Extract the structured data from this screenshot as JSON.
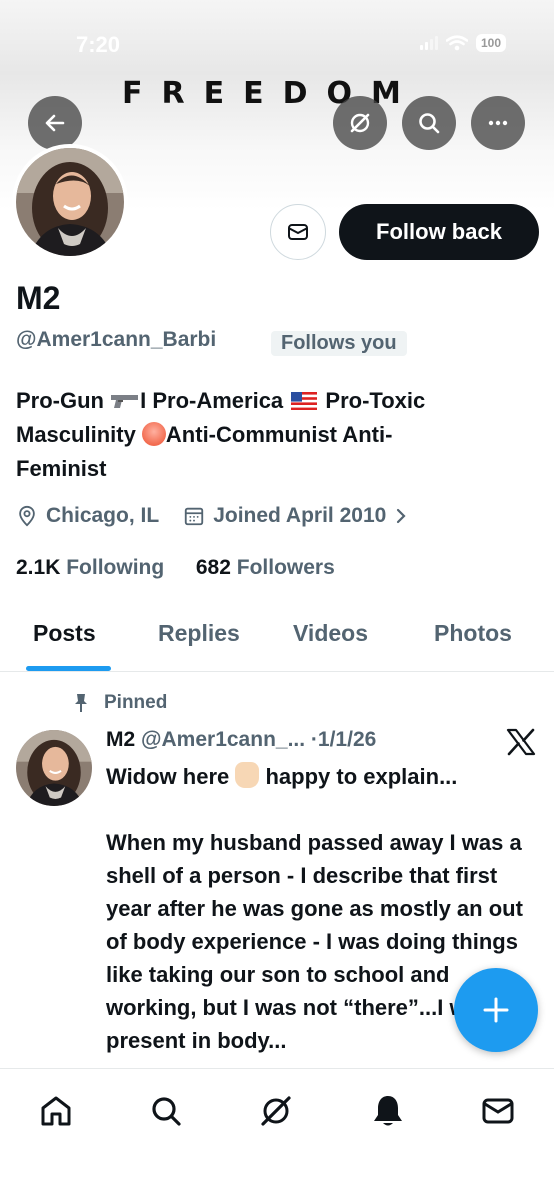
{
  "status_bar": {
    "time": "7:20",
    "battery": "100"
  },
  "banner": {
    "text": "FREEDOM"
  },
  "profile": {
    "name": "M2",
    "handle": "@Amer1cann_Barbi",
    "follows_you": "Follows you",
    "follow_button": "Follow back",
    "bio": {
      "line1_a": "Pro-Gun ",
      "line1_b": "I Pro-America ",
      "line1_c": " Pro-Toxic",
      "line2_a": "Masculinity ",
      "line2_b": "Anti-Communist Anti-",
      "line3": "Feminist"
    },
    "location": "Chicago, IL",
    "joined": "Joined April 2010",
    "following_count": "2.1K",
    "following_label": "Following",
    "followers_count": "682",
    "followers_label": "Followers"
  },
  "tabs": [
    {
      "label": "Posts",
      "active": true
    },
    {
      "label": "Replies",
      "active": false
    },
    {
      "label": "Videos",
      "active": false
    },
    {
      "label": "Photos",
      "active": false
    }
  ],
  "pinned_post": {
    "pinned_label": "Pinned",
    "author": "M2",
    "handle": "@Amer1cann_...",
    "separator": "·",
    "date": "1/1/26",
    "line1_a": "Widow here ",
    "line1_b": " happy to explain...",
    "paragraph": "When my husband passed away I was a shell of a person - I describe that first year after he was gone as mostly an out of body experience - I was doing things like taking our son to school and working, but I was not “there”...I was present in body..."
  },
  "colors": {
    "accent": "#1d9bf0",
    "text": "#0f1419",
    "secondary": "#536471"
  },
  "icons": [
    "back-icon",
    "grok-icon",
    "search-icon",
    "more-icon",
    "envelope-icon",
    "location-icon",
    "calendar-icon",
    "pin-icon",
    "x-logo-icon",
    "plus-icon",
    "home-icon",
    "notifications-icon"
  ]
}
